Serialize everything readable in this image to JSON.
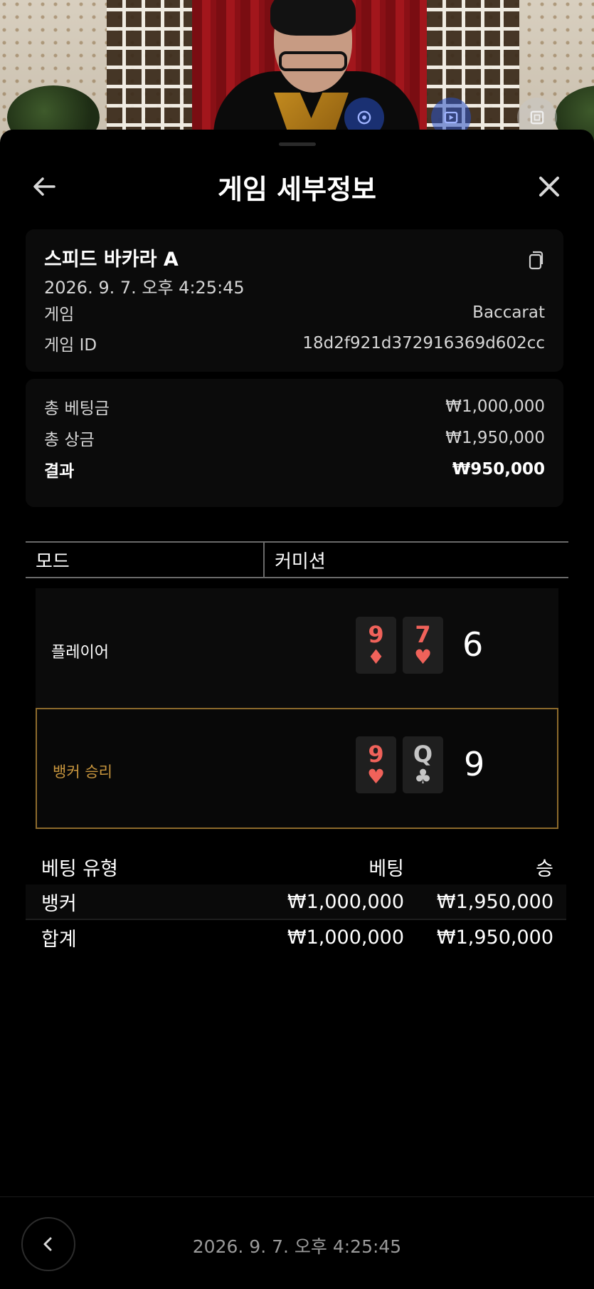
{
  "header": {
    "title": "게임 세부정보"
  },
  "details": {
    "table_name": "스피드 바카라 A",
    "datetime": "2026. 9. 7. 오후 4:25:45",
    "game_label": "게임",
    "game_value": "Baccarat",
    "game_id_label": "게임 ID",
    "game_id_value": "18d2f921d372916369d602cc"
  },
  "summary": {
    "total_bet_label": "총 베팅금",
    "total_bet_value": "₩1,000,000",
    "total_win_label": "총 상금",
    "total_win_value": "₩1,950,000",
    "result_label": "결과",
    "result_value": "₩950,000"
  },
  "mode": {
    "label": "모드",
    "value": "커미션"
  },
  "hands": {
    "player": {
      "label": "플레이어",
      "cards": [
        {
          "rank": "9",
          "suit": "♦",
          "color": "#f0625a"
        },
        {
          "rank": "7",
          "suit": "♥",
          "color": "#f0625a"
        }
      ],
      "score": "6"
    },
    "banker": {
      "label": "뱅커 승리",
      "cards": [
        {
          "rank": "9",
          "suit": "♥",
          "color": "#f0625a"
        },
        {
          "rank": "Q",
          "suit": "♣",
          "color": "#c5c5c5"
        }
      ],
      "score": "9"
    }
  },
  "bets": {
    "headers": [
      "베팅 유형",
      "베팅",
      "승"
    ],
    "rows": [
      {
        "type": "뱅커",
        "bet": "₩1,000,000",
        "win": "₩1,950,000"
      }
    ],
    "total": {
      "type": "합계",
      "bet": "₩1,000,000",
      "win": "₩1,950,000"
    }
  },
  "footer": {
    "datetime": "2026. 9. 7. 오후 4:25:45"
  },
  "colors": {
    "accent_gold": "#8c6a2c",
    "card_red": "#f0625a"
  }
}
